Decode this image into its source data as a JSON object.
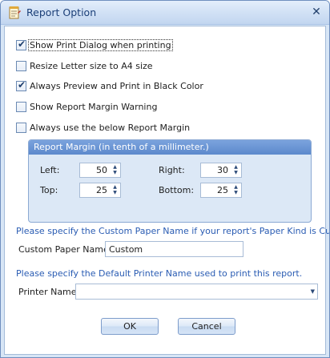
{
  "window": {
    "title": "Report Option",
    "close_glyph": "✕"
  },
  "options": [
    {
      "label": "Show Print Dialog when printing",
      "checked": true
    },
    {
      "label": "Resize Letter size to A4 size",
      "checked": false
    },
    {
      "label": "Always Preview and Print in Black Color",
      "checked": true
    },
    {
      "label": "Show Report Margin Warning",
      "checked": false
    },
    {
      "label": "Always use the below Report Margin",
      "checked": false
    }
  ],
  "margin": {
    "header": "Report Margin (in tenth of a millimeter.)",
    "left_label": "Left:",
    "left_value": "50",
    "top_label": "Top:",
    "top_value": "25",
    "right_label": "Right:",
    "right_value": "30",
    "bottom_label": "Bottom:",
    "bottom_value": "25"
  },
  "paper": {
    "hint": "Please specify the Custom Paper Name if your report's Paper Kind is Custom.",
    "label": "Custom Paper Name:",
    "value": "Custom"
  },
  "printer": {
    "hint": "Please specify the Default Printer Name used to print this report.",
    "label": "Printer Name:",
    "value": ""
  },
  "buttons": {
    "ok": "OK",
    "cancel": "Cancel"
  },
  "icons": {
    "title": "report-notepad-icon",
    "spin_up": "▲",
    "spin_down": "▼",
    "combo": "▼",
    "check": "✔"
  }
}
